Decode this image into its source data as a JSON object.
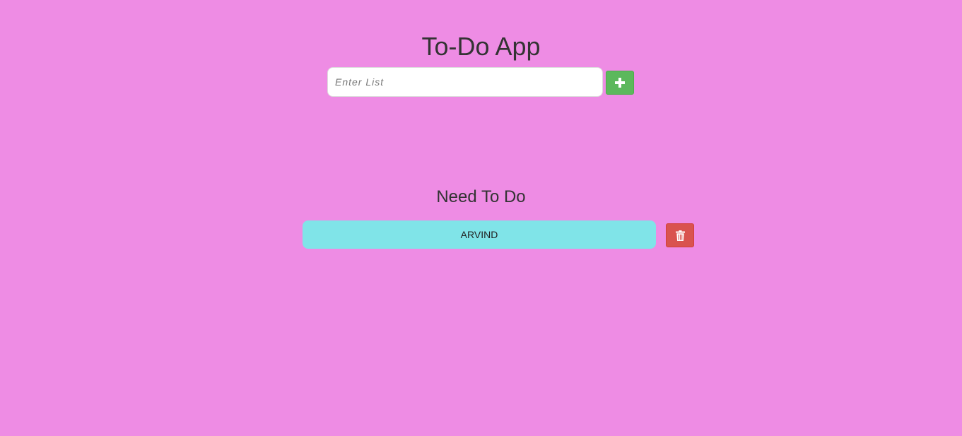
{
  "app": {
    "title": "To-Do App"
  },
  "input": {
    "placeholder": "Enter List",
    "value": ""
  },
  "add_button": {
    "icon": "plus-icon"
  },
  "section": {
    "title": "Need To Do"
  },
  "todos": [
    {
      "text": "ARVIND",
      "delete_icon": "trash-icon"
    }
  ],
  "colors": {
    "background": "#ee8ce4",
    "item": "#80e4e8",
    "add": "#5cb85c",
    "delete": "#d9534f",
    "text": "#333333"
  }
}
